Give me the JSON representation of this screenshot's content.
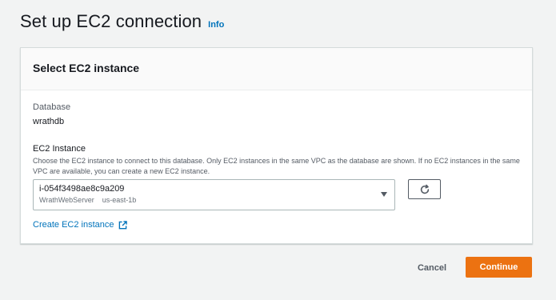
{
  "page": {
    "title": "Set up EC2 connection",
    "info_label": "Info"
  },
  "panel": {
    "title": "Select EC2 instance",
    "database": {
      "label": "Database",
      "value": "wrathdb"
    },
    "ec2_instance": {
      "label": "EC2 Instance",
      "description": "Choose the EC2 instance to connect to this database. Only EC2 instances in the same VPC as the database are shown. If no EC2 instances in the same VPC are available, you can create a new EC2 instance.",
      "selected_value": "i-054f3498ae8c9a209",
      "selected_name": "WrathWebServer",
      "selected_zone": "us-east-1b"
    },
    "refresh_icon": "refresh-icon",
    "create_link_label": "Create EC2 instance",
    "create_link_icon": "external-link-icon"
  },
  "actions": {
    "cancel_label": "Cancel",
    "continue_label": "Continue"
  },
  "colors": {
    "accent": "#ec7211",
    "link": "#0073bb",
    "background": "#f2f3f3"
  }
}
